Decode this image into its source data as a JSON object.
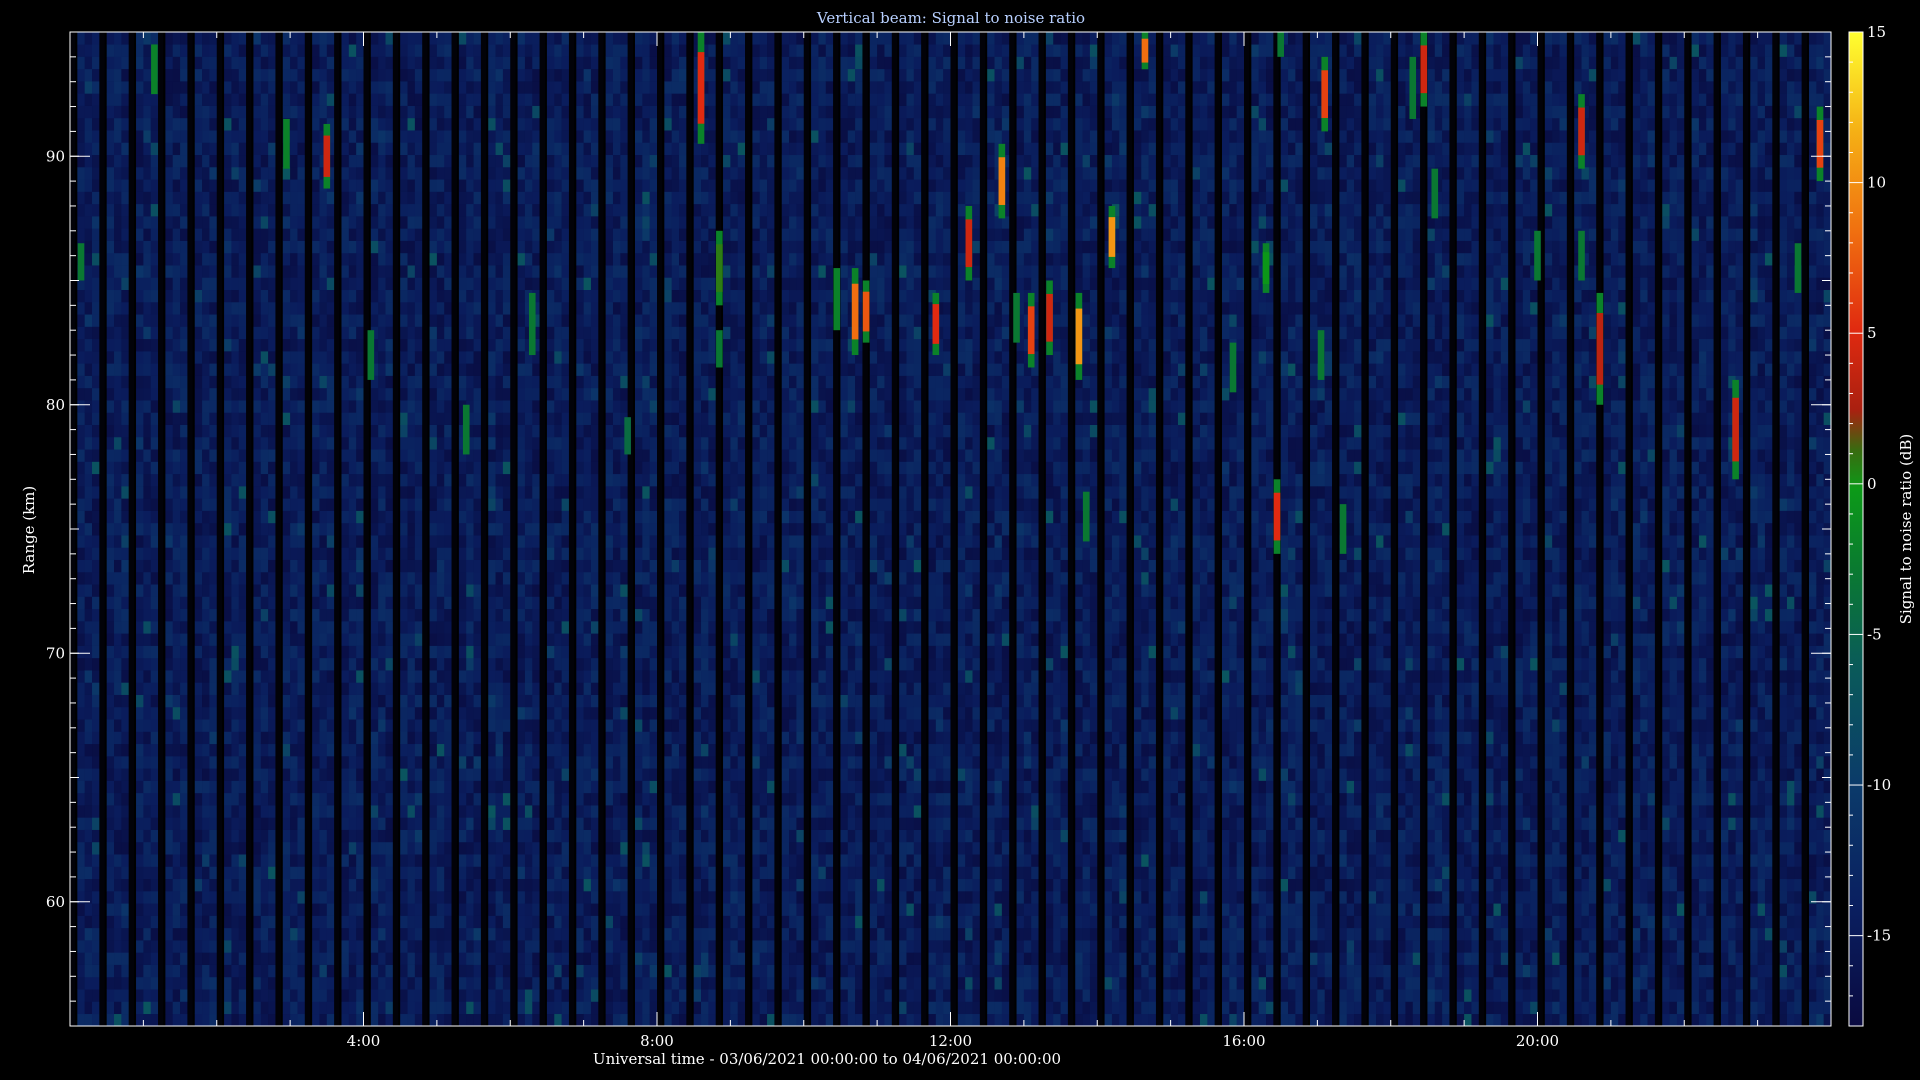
{
  "chart_data": {
    "type": "heatmap",
    "title": "Vertical beam: Signal to noise ratio",
    "xlabel": "Universal time - 03/06/2021 00:00:00 to 04/06/2021 00:00:00",
    "ylabel": "Range (km)",
    "colorbar_label": "Signal to noise ratio (dB)",
    "xlim_hours": [
      0,
      24
    ],
    "ylim_km": [
      55,
      95
    ],
    "clim_db": [
      -18,
      15
    ],
    "x_ticks": [
      {
        "hour": 4,
        "label": "4:00"
      },
      {
        "hour": 8,
        "label": "8:00"
      },
      {
        "hour": 12,
        "label": "12:00"
      },
      {
        "hour": 16,
        "label": "16:00"
      },
      {
        "hour": 20,
        "label": "20:00"
      }
    ],
    "y_ticks": [
      {
        "km": 60,
        "label": "60"
      },
      {
        "km": 70,
        "label": "70"
      },
      {
        "km": 80,
        "label": "80"
      },
      {
        "km": 90,
        "label": "90"
      }
    ],
    "colorbar_ticks": [
      {
        "db": 15,
        "label": "15"
      },
      {
        "db": 10,
        "label": "10"
      },
      {
        "db": 5,
        "label": "5"
      },
      {
        "db": 0,
        "label": "0"
      },
      {
        "db": -5,
        "label": "-5"
      },
      {
        "db": -10,
        "label": "-10"
      },
      {
        "db": -15,
        "label": "-15"
      }
    ],
    "background_db": -15,
    "echoes": [
      {
        "hour": 0.15,
        "km_from": 85.0,
        "km_to": 86.5,
        "db": -6
      },
      {
        "hour": 1.15,
        "km_from": 92.5,
        "km_to": 94.5,
        "db": -5
      },
      {
        "hour": 2.95,
        "km_from": 89.5,
        "km_to": 91.5,
        "db": -5
      },
      {
        "hour": 3.5,
        "km_from": 88.7,
        "km_to": 91.3,
        "db": 2
      },
      {
        "hour": 4.1,
        "km_from": 81.0,
        "km_to": 83.0,
        "db": -6
      },
      {
        "hour": 5.4,
        "km_from": 78.0,
        "km_to": 80.0,
        "db": -6
      },
      {
        "hour": 6.3,
        "km_from": 82.0,
        "km_to": 84.5,
        "db": -6
      },
      {
        "hour": 7.6,
        "km_from": 78.0,
        "km_to": 79.5,
        "db": -7
      },
      {
        "hour": 8.6,
        "km_from": 90.5,
        "km_to": 95.0,
        "db": 3
      },
      {
        "hour": 8.85,
        "km_from": 84.0,
        "km_to": 87.0,
        "db": -2
      },
      {
        "hour": 8.85,
        "km_from": 81.5,
        "km_to": 83.0,
        "db": -6
      },
      {
        "hour": 10.45,
        "km_from": 83.0,
        "km_to": 85.5,
        "db": -4
      },
      {
        "hour": 10.7,
        "km_from": 82.0,
        "km_to": 85.5,
        "db": 6
      },
      {
        "hour": 10.85,
        "km_from": 82.5,
        "km_to": 85.0,
        "db": 5
      },
      {
        "hour": 11.8,
        "km_from": 82.0,
        "km_to": 84.5,
        "db": 3
      },
      {
        "hour": 12.25,
        "km_from": 85.0,
        "km_to": 88.0,
        "db": 2
      },
      {
        "hour": 12.7,
        "km_from": 87.5,
        "km_to": 90.5,
        "db": 7
      },
      {
        "hour": 12.9,
        "km_from": 82.5,
        "km_to": 84.5,
        "db": -6
      },
      {
        "hour": 13.1,
        "km_from": 81.5,
        "km_to": 84.5,
        "db": 4
      },
      {
        "hour": 13.35,
        "km_from": 82.0,
        "km_to": 85.0,
        "db": 2
      },
      {
        "hour": 13.75,
        "km_from": 81.0,
        "km_to": 84.5,
        "db": 8
      },
      {
        "hour": 13.85,
        "km_from": 74.5,
        "km_to": 76.5,
        "db": -6
      },
      {
        "hour": 14.2,
        "km_from": 85.5,
        "km_to": 88.0,
        "db": 8
      },
      {
        "hour": 14.65,
        "km_from": 93.5,
        "km_to": 95.0,
        "db": 6
      },
      {
        "hour": 15.85,
        "km_from": 80.5,
        "km_to": 82.5,
        "db": -6
      },
      {
        "hour": 16.3,
        "km_from": 84.5,
        "km_to": 86.5,
        "db": -3
      },
      {
        "hour": 16.45,
        "km_from": 74.0,
        "km_to": 77.0,
        "db": 3
      },
      {
        "hour": 16.5,
        "km_from": 94.0,
        "km_to": 95.0,
        "db": -6
      },
      {
        "hour": 17.05,
        "km_from": 81.0,
        "km_to": 83.0,
        "db": -6
      },
      {
        "hour": 17.1,
        "km_from": 91.0,
        "km_to": 94.0,
        "db": 4
      },
      {
        "hour": 17.35,
        "km_from": 74.0,
        "km_to": 76.0,
        "db": -6
      },
      {
        "hour": 18.3,
        "km_from": 91.5,
        "km_to": 94.0,
        "db": -6
      },
      {
        "hour": 18.45,
        "km_from": 92.0,
        "km_to": 95.0,
        "db": 2
      },
      {
        "hour": 18.6,
        "km_from": 87.5,
        "km_to": 89.5,
        "db": -6
      },
      {
        "hour": 20.0,
        "km_from": 85.0,
        "km_to": 87.0,
        "db": -6
      },
      {
        "hour": 20.6,
        "km_from": 89.5,
        "km_to": 92.5,
        "db": 2
      },
      {
        "hour": 20.6,
        "km_from": 85.0,
        "km_to": 87.0,
        "db": -6
      },
      {
        "hour": 20.85,
        "km_from": 80.0,
        "km_to": 84.5,
        "db": 1
      },
      {
        "hour": 22.7,
        "km_from": 77.0,
        "km_to": 81.0,
        "db": 2
      },
      {
        "hour": 23.85,
        "km_from": 89.0,
        "km_to": 92.0,
        "db": 4
      },
      {
        "hour": 23.55,
        "km_from": 84.5,
        "km_to": 86.5,
        "db": -6
      }
    ]
  }
}
